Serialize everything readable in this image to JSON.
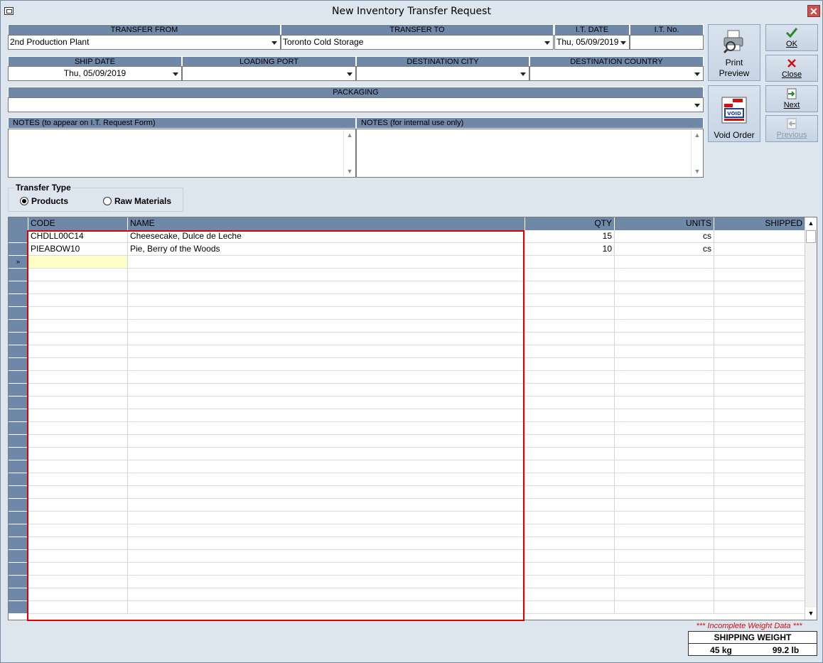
{
  "window": {
    "title": "New Inventory Transfer Request"
  },
  "header": {
    "transfer_from": {
      "label": "TRANSFER FROM",
      "value": "2nd Production Plant"
    },
    "transfer_to": {
      "label": "TRANSFER TO",
      "value": "Toronto Cold Storage"
    },
    "it_date": {
      "label": "I.T. DATE",
      "value": "Thu, 05/09/2019"
    },
    "it_no": {
      "label": "I.T. No.",
      "value": ""
    },
    "ship_date": {
      "label": "SHIP DATE",
      "value": "Thu, 05/09/2019"
    },
    "loading_port": {
      "label": "LOADING PORT",
      "value": ""
    },
    "destination_city": {
      "label": "DESTINATION CITY",
      "value": ""
    },
    "destination_country": {
      "label": "DESTINATION COUNTRY",
      "value": ""
    },
    "packaging": {
      "label": "PACKAGING",
      "value": ""
    },
    "notes_form": {
      "label": "NOTES (to appear on I.T. Request Form)",
      "value": ""
    },
    "notes_internal": {
      "label": "NOTES (for internal use only)",
      "value": ""
    }
  },
  "buttons": {
    "print_preview_1": "Print",
    "print_preview_2": "Preview",
    "void_order": "Void Order",
    "void_stamp": "VOID",
    "ok": "OK",
    "close": "Close",
    "next": "Next",
    "previous": "Previous"
  },
  "transfer_type": {
    "title": "Transfer Type",
    "options": [
      "Products",
      "Raw Materials"
    ],
    "selected": "Products"
  },
  "grid": {
    "columns": [
      "CODE",
      "NAME",
      "QTY",
      "UNITS",
      "SHIPPED"
    ],
    "rows": [
      {
        "code": "CHDLL00C14",
        "name": "Cheesecake, Dulce de Leche",
        "qty": "15",
        "units": "cs",
        "shipped": ""
      },
      {
        "code": "PIEABOW10",
        "name": "Pie, Berry of the Woods",
        "qty": "10",
        "units": "cs",
        "shipped": ""
      }
    ],
    "new_row_marker": "»"
  },
  "footer": {
    "warning": "*** Incomplete Weight Data ***",
    "shipping_weight_label": "SHIPPING WEIGHT",
    "kg": "45 kg",
    "lb": "99.2 lb"
  },
  "colors": {
    "header_blue": "#6f88a8",
    "highlight_red": "#e00000",
    "warning_red": "#d01010"
  }
}
